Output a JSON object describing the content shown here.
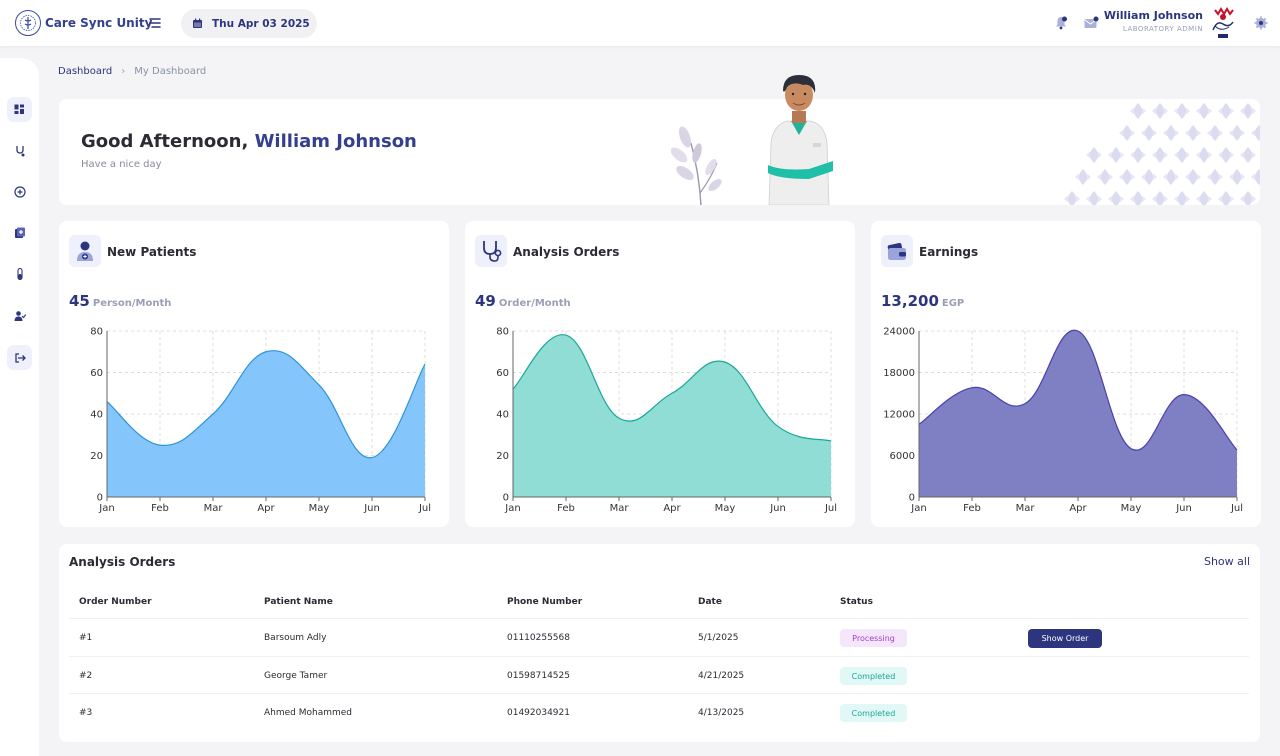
{
  "app": {
    "title": "Care Sync Unity"
  },
  "header": {
    "date": "Thu Apr 03 2025",
    "user_name": "William Johnson",
    "user_role": "LABORATORY ADMIN"
  },
  "breadcrumb": {
    "home": "Dashboard",
    "separator": "›",
    "current": "My Dashboard"
  },
  "welcome": {
    "greeting_prefix": "Good Afternoon, ",
    "name": "William Johnson",
    "subtitle": "Have a nice day"
  },
  "cards": [
    {
      "title": "New Patients",
      "value": "45",
      "unit": "Person/Month",
      "icon": "patient-icon"
    },
    {
      "title": "Analysis Orders",
      "value": "49",
      "unit": "Order/Month",
      "icon": "stethoscope-icon"
    },
    {
      "title": "Earnings",
      "value": "13,200",
      "unit": "EGP",
      "icon": "wallet-icon"
    }
  ],
  "chart_data": [
    {
      "type": "area",
      "categories": [
        "Jan",
        "Feb",
        "Mar",
        "Apr",
        "May",
        "Jun",
        "Jul"
      ],
      "values": [
        46,
        25,
        40,
        70,
        54,
        19,
        64
      ],
      "ylim": [
        0,
        80
      ],
      "yticks": [
        0,
        20,
        40,
        60,
        80
      ],
      "color": "#84c5fb",
      "stroke": "#2f93d8"
    },
    {
      "type": "area",
      "categories": [
        "Jan",
        "Feb",
        "Mar",
        "Apr",
        "May",
        "Jun",
        "Jul"
      ],
      "values": [
        52,
        78,
        38,
        50,
        65,
        34,
        27
      ],
      "ylim": [
        0,
        80
      ],
      "yticks": [
        0,
        20,
        40,
        60,
        80
      ],
      "color": "#8fddd4",
      "stroke": "#1aa896"
    },
    {
      "type": "area",
      "categories": [
        "Jan",
        "Feb",
        "Mar",
        "Apr",
        "May",
        "Jun",
        "Jul"
      ],
      "values": [
        10500,
        15800,
        13500,
        24000,
        7000,
        14800,
        6800
      ],
      "ylim": [
        0,
        24000
      ],
      "yticks": [
        0,
        6000,
        12000,
        18000,
        24000
      ],
      "color": "#7f7fc3",
      "stroke": "#4b3fb0"
    }
  ],
  "orders": {
    "title": "Analysis Orders",
    "show_all": "Show all",
    "headers": [
      "Order Number",
      "Patient Name",
      "Phone Number",
      "Date",
      "Status"
    ],
    "rows": [
      {
        "number": "#1",
        "patient": "Barsoum Adly",
        "phone": "01110255568",
        "date": "5/1/2025",
        "status": "Processing",
        "action": "Show Order"
      },
      {
        "number": "#2",
        "patient": "George Tamer",
        "phone": "01598714525",
        "date": "4/21/2025",
        "status": "Completed"
      },
      {
        "number": "#3",
        "patient": "Ahmed Mohammed",
        "phone": "01492034921",
        "date": "4/13/2025",
        "status": "Completed"
      }
    ]
  },
  "colors": {
    "primary": "#2d357e",
    "processing_bg": "#f4e6fb",
    "processing_text": "#a13fc9",
    "completed_bg": "#e2f8f6",
    "completed_text": "#1aa896"
  }
}
